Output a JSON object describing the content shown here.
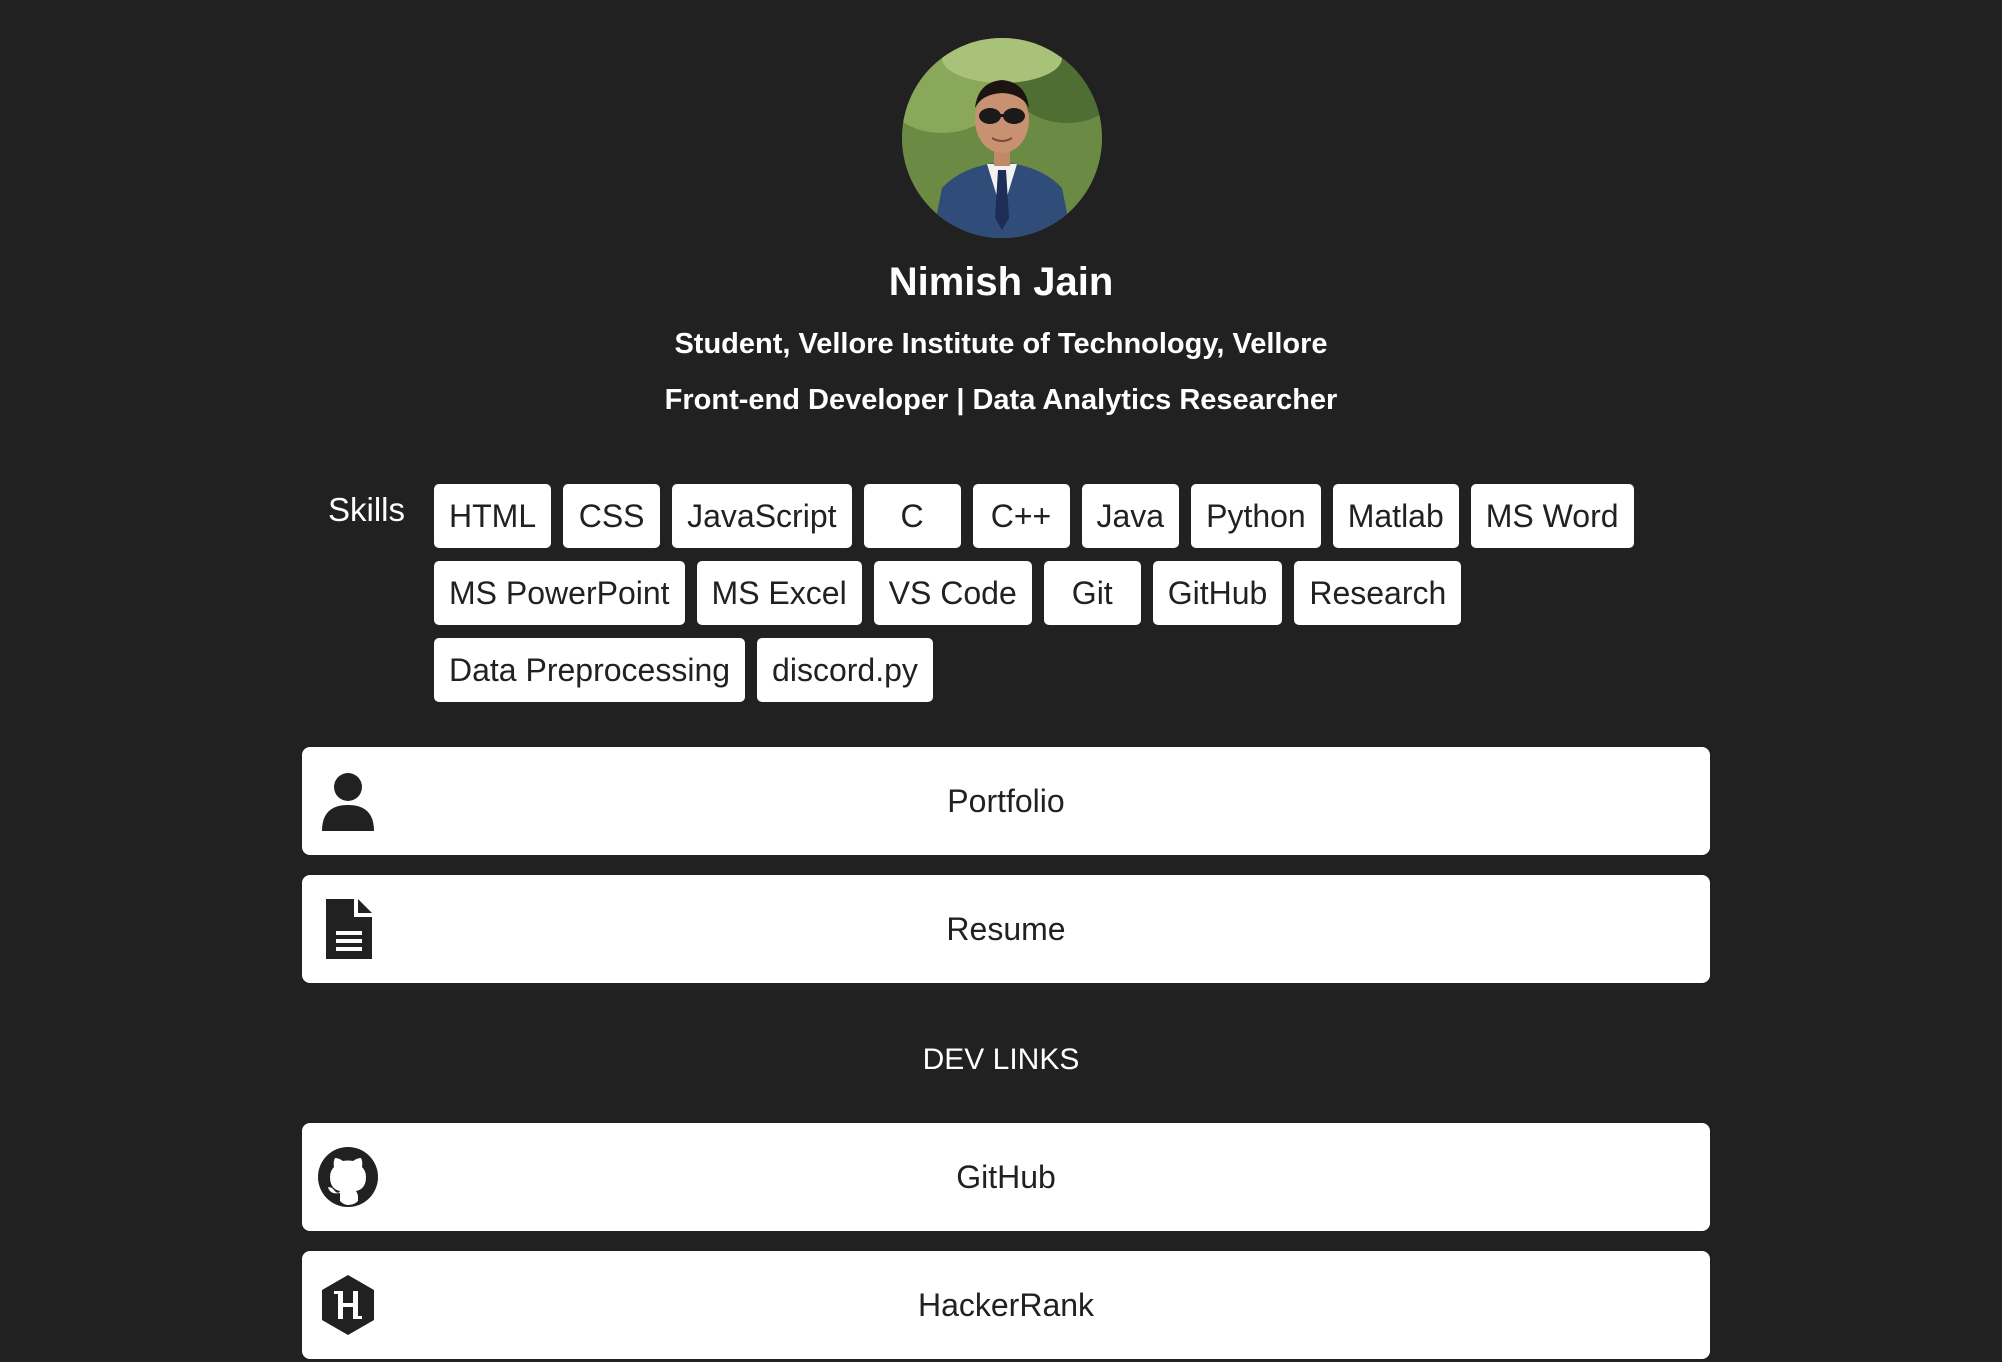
{
  "profile": {
    "avatar_alt": "profile photo",
    "name": "Nimish Jain",
    "subtitle_line1": "Student, Vellore Institute of Technology, Vellore",
    "subtitle_line2": "Front-end Developer | Data Analytics Researcher"
  },
  "skills": {
    "label": "Skills",
    "items": [
      "HTML",
      "CSS",
      "JavaScript",
      "C",
      "C++",
      "Java",
      "Python",
      "Matlab",
      "MS Word",
      "MS PowerPoint",
      "MS Excel",
      "VS Code",
      "Git",
      "GitHub",
      "Research",
      "Data Preprocessing",
      "discord.py"
    ]
  },
  "links": [
    {
      "label": "Portfolio",
      "icon": "user-icon"
    },
    {
      "label": "Resume",
      "icon": "document-icon"
    }
  ],
  "dev_links": {
    "heading": "DEV LINKS",
    "items": [
      {
        "label": "GitHub",
        "icon": "github-icon"
      },
      {
        "label": "HackerRank",
        "icon": "hackerrank-icon"
      }
    ]
  },
  "colors": {
    "background": "#212121",
    "card": "#ffffff",
    "text_dark": "#212121",
    "text_light": "#ffffff"
  }
}
